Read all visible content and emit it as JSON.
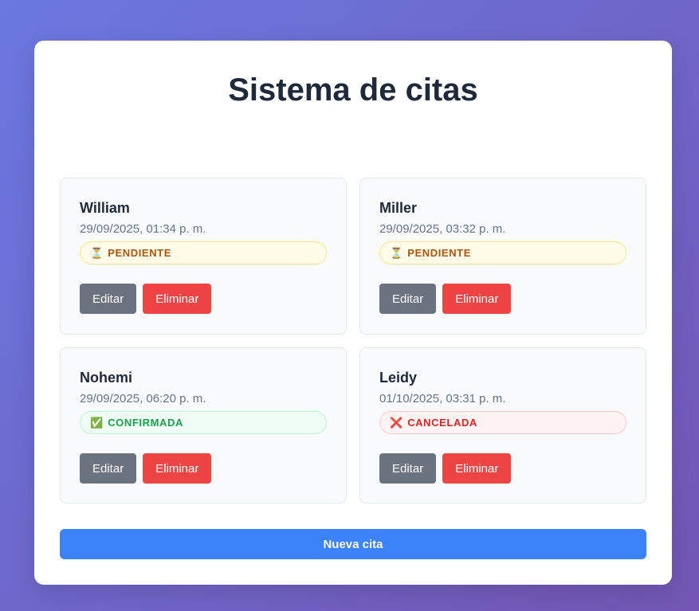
{
  "page": {
    "title": "Sistema de citas"
  },
  "appointments": [
    {
      "name": "William",
      "datetime": "29/09/2025, 01:34 p. m.",
      "status_icon": "⏳",
      "status": "PENDIENTE",
      "status_color": "#b45309",
      "edit_label": "Editar",
      "delete_label": "Eliminar"
    },
    {
      "name": "Miller",
      "datetime": "29/09/2025, 03:32 p. m.",
      "status_icon": "⏳",
      "status": "PENDIENTE",
      "status_color": "#b45309",
      "edit_label": "Editar",
      "delete_label": "Eliminar"
    },
    {
      "name": "Nohemi",
      "datetime": "29/09/2025, 06:20 p. m.",
      "status_icon": "✅",
      "status": "CONFIRMADA",
      "status_color": "#16a34a",
      "edit_label": "Editar",
      "delete_label": "Eliminar"
    },
    {
      "name": "Leidy",
      "datetime": "01/10/2025, 03:31 p. m.",
      "status_icon": "❌",
      "status": "CANCELADA",
      "status_color": "#dc2626",
      "edit_label": "Editar",
      "delete_label": "Eliminar"
    }
  ],
  "footer": {
    "new_label": "Nueva cita"
  },
  "colors": {
    "primary": "#3b82f6",
    "edit": "#6b7280",
    "delete": "#ef4444"
  }
}
